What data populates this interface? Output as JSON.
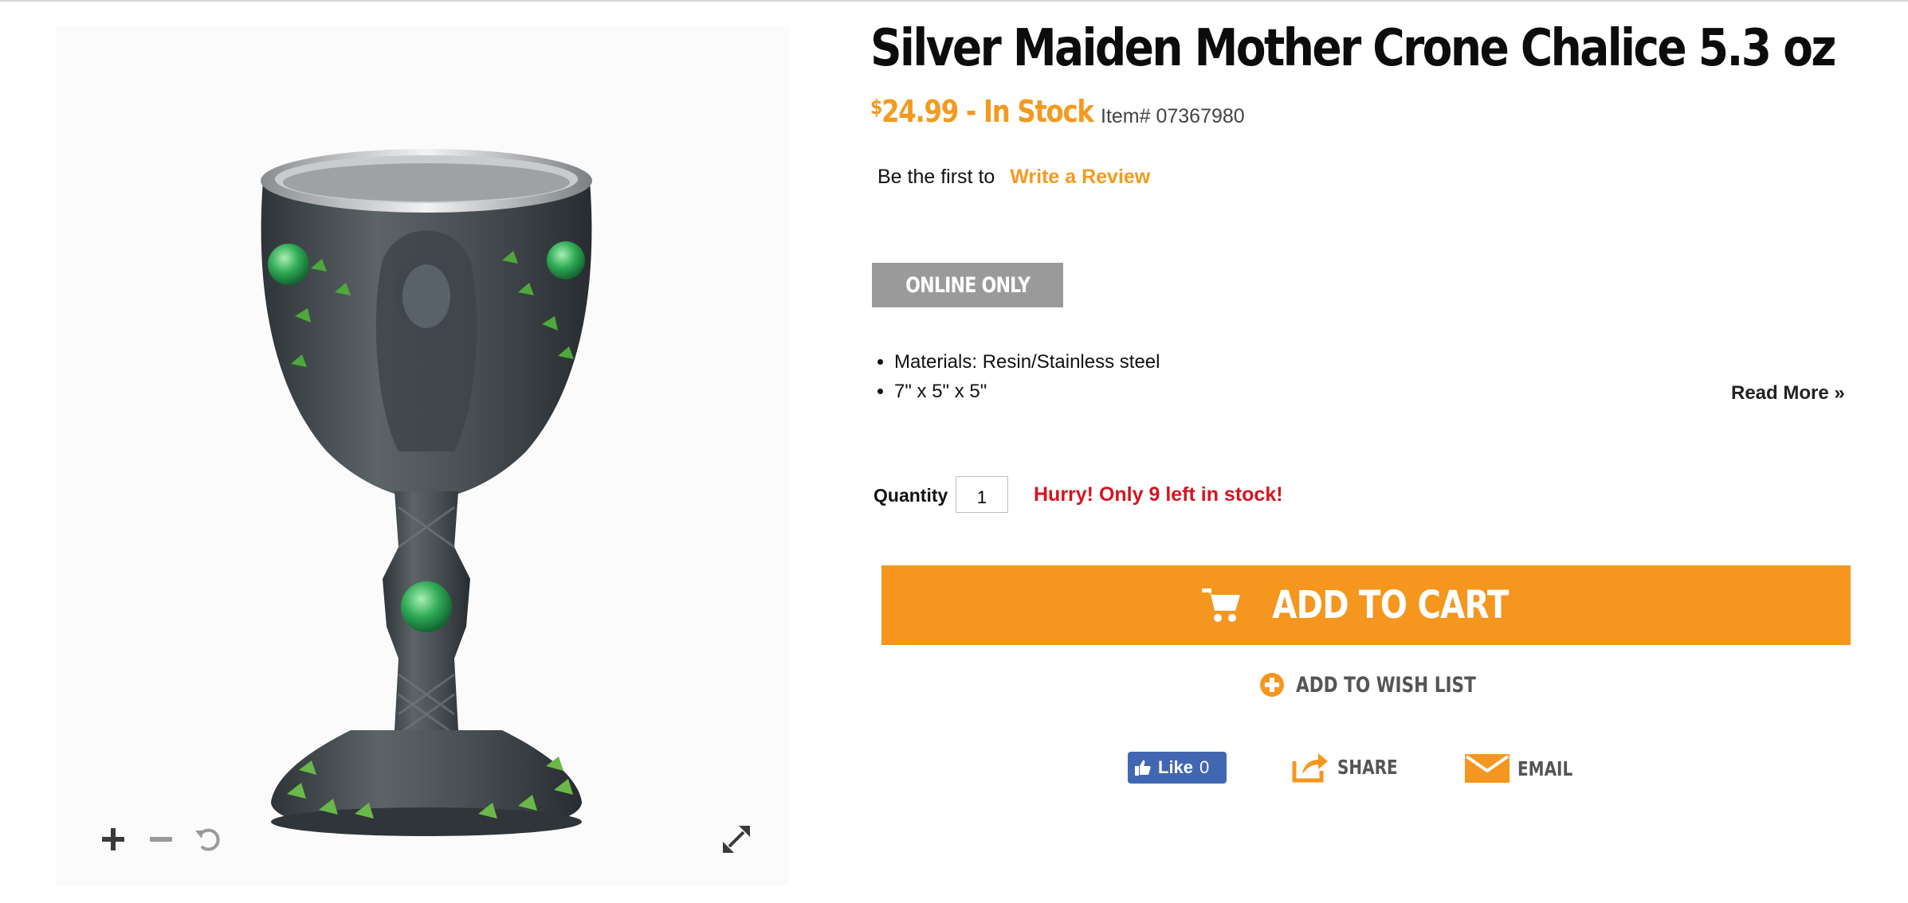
{
  "product": {
    "title": "Silver Maiden Mother Crone Chalice 5.3 oz",
    "currency_symbol": "$",
    "price_text": "24.99 - In Stock",
    "item_number": "Item# 07367980"
  },
  "reviews": {
    "lead_text": "Be the first to",
    "link_label": "Write a Review"
  },
  "badge": {
    "label": "ONLINE ONLY",
    "color": "#9a9a9a"
  },
  "features": [
    "Materials: Resin/Stainless steel",
    "7\" x 5\" x 5\""
  ],
  "read_more_label": "Read More »",
  "quantity": {
    "label": "Quantity",
    "value": "1"
  },
  "stock_alert": "Hurry! Only 9 left in stock!",
  "add_to_cart_label": "ADD TO CART",
  "wishlist_label": "ADD TO WISH LIST",
  "social": {
    "like_label": "Like",
    "like_count": "0",
    "share_label": "SHARE",
    "email_label": "EMAIL"
  },
  "image_tools": [
    "zoom-in-icon",
    "zoom-out-icon",
    "reset-icon",
    "fullscreen-icon"
  ],
  "colors": {
    "accent": "#f5961e",
    "price": "#f39a1f",
    "alert": "#d7141f",
    "facebook": "#4267b2"
  }
}
